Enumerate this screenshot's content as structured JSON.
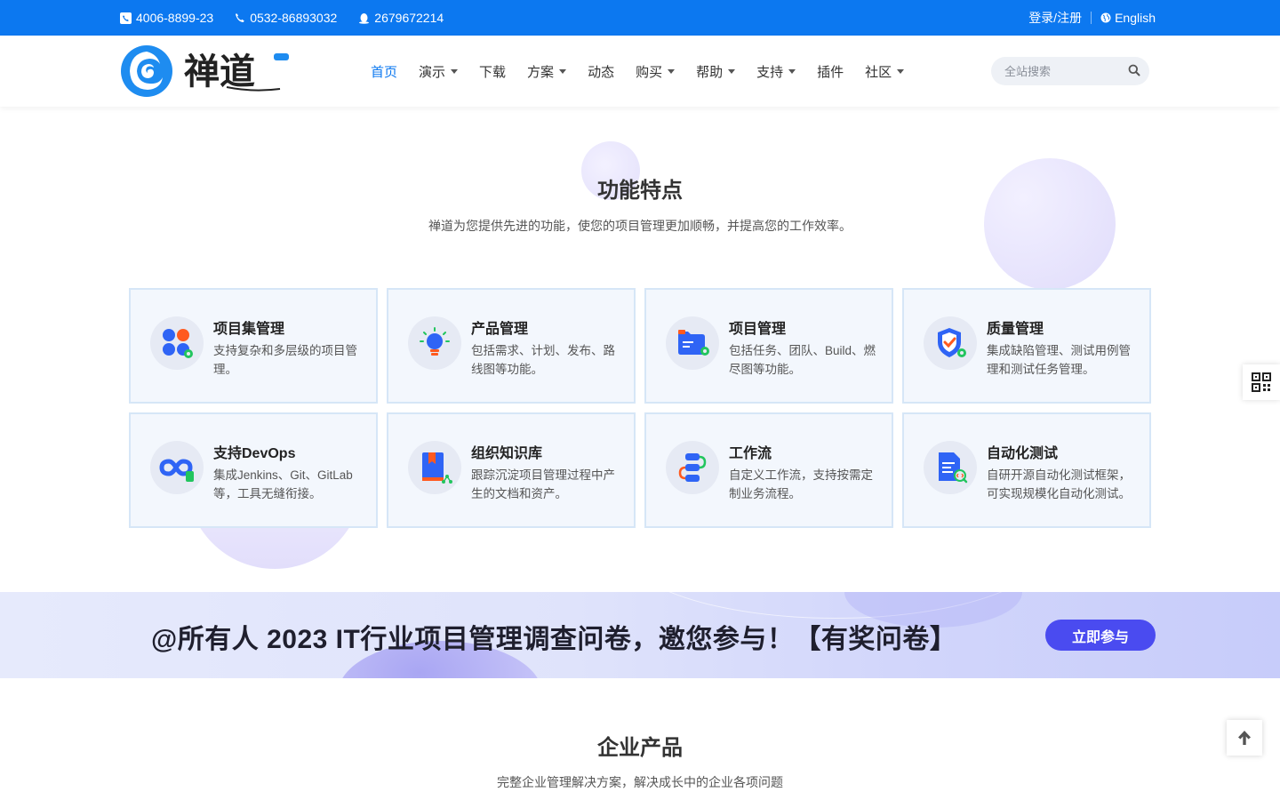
{
  "topbar": {
    "phone1": "4006-8899-23",
    "phone2": "0532-86893032",
    "qq": "2679672214",
    "login": "登录/注册",
    "language": "English"
  },
  "header": {
    "nav": [
      {
        "label": "首页",
        "active": true,
        "dropdown": false
      },
      {
        "label": "演示",
        "dropdown": true
      },
      {
        "label": "下载",
        "dropdown": false
      },
      {
        "label": "方案",
        "dropdown": true
      },
      {
        "label": "动态",
        "dropdown": false
      },
      {
        "label": "购买",
        "dropdown": true
      },
      {
        "label": "帮助",
        "dropdown": true
      },
      {
        "label": "支持",
        "dropdown": true
      },
      {
        "label": "插件",
        "dropdown": false
      },
      {
        "label": "社区",
        "dropdown": true
      }
    ],
    "search_placeholder": "全站搜索"
  },
  "features": {
    "title": "功能特点",
    "subtitle": "禅道为您提供先进的功能，使您的项目管理更加顺畅，并提高您的工作效率。",
    "cards": [
      {
        "icon": "program-icon",
        "title": "项目集管理",
        "desc": "支持复杂和多层级的项目管理。"
      },
      {
        "icon": "lightbulb-icon",
        "title": "产品管理",
        "desc": "包括需求、计划、发布、路线图等功能。"
      },
      {
        "icon": "folder-icon",
        "title": "项目管理",
        "desc": "包括任务、团队、Build、燃尽图等功能。"
      },
      {
        "icon": "shield-check-icon",
        "title": "质量管理",
        "desc": "集成缺陷管理、测试用例管理和测试任务管理。"
      },
      {
        "icon": "infinity-icon",
        "title": "支持DevOps",
        "desc": "集成Jenkins、Git、GitLab等，工具无缝衔接。"
      },
      {
        "icon": "book-icon",
        "title": "组织知识库",
        "desc": "跟踪沉淀项目管理过程中产生的文档和资产。"
      },
      {
        "icon": "workflow-icon",
        "title": "工作流",
        "desc": "自定义工作流，支持按需定制业务流程。"
      },
      {
        "icon": "auto-test-icon",
        "title": "自动化测试",
        "desc": "自研开源自动化测试框架，可实现规模化自动化测试。"
      }
    ]
  },
  "banner": {
    "text": "@所有人 2023 IT行业项目管理调查问卷，邀您参与！【有奖问卷】",
    "button": "立即参与"
  },
  "products": {
    "title": "企业产品",
    "subtitle": "完整企业管理解决方案，解决成长中的企业各项问题"
  },
  "colors": {
    "brand_blue": "#0c78f0",
    "banner_button": "#4a4bf0"
  }
}
